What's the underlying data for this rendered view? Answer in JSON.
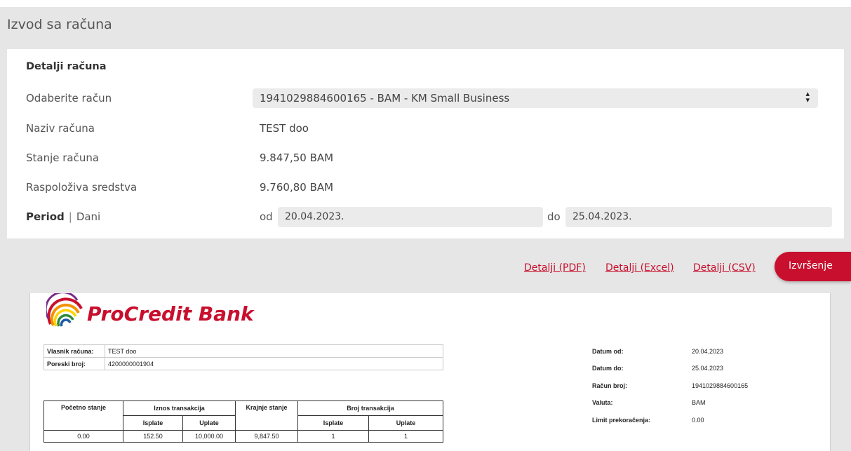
{
  "header": {
    "title": "Izvod sa računa"
  },
  "details": {
    "section_title": "Detalji računa",
    "select_account_label": "Odaberite račun",
    "select_account_value": "1941029884600165 - BAM - KM Small Business",
    "account_name_label": "Naziv računa",
    "account_name_value": "TEST doo",
    "balance_label": "Stanje računa",
    "balance_value": "9.847,50 BAM",
    "available_label": "Raspoloživa sredstva",
    "available_value": "9.760,80 BAM"
  },
  "period": {
    "label_period": "Period",
    "separator": "|",
    "label_days": "Dani",
    "from_prefix": "od",
    "from_value": "20.04.2023.",
    "to_prefix": "do",
    "to_value": "25.04.2023."
  },
  "actions": {
    "pdf_link": "Detalji (PDF)",
    "excel_link": "Detalji (Excel)",
    "csv_link": "Detalji (CSV)",
    "execute_button": "Izvršenje",
    "accent_color": "#c8102e"
  },
  "statement": {
    "bank_name": "ProCredit Bank",
    "owner_label": "Vlasnik računa:",
    "owner_value": "TEST doo",
    "tax_label": "Poreski broj:",
    "tax_value": "4200000001904",
    "table": {
      "col_opening": "Početno stanje",
      "col_amount": "Iznos transakcija",
      "col_closing": "Krajnje stanje",
      "col_count": "Broj transakcija",
      "sub_out": "Isplate",
      "sub_in": "Uplate",
      "sub_out2": "Isplate",
      "sub_in2": "Uplate",
      "row": {
        "opening": "0.00",
        "out_amount": "152.50",
        "in_amount": "10,000.00",
        "closing": "9,847.50",
        "out_count": "1",
        "in_count": "1"
      }
    },
    "meta": {
      "date_from_label": "Datum od:",
      "date_from_value": "20.04.2023",
      "date_to_label": "Datum do:",
      "date_to_value": "25.04.2023",
      "account_no_label": "Račun broj:",
      "account_no_value": "1941029884600165",
      "currency_label": "Valuta:",
      "currency_value": "BAM",
      "overdraft_label": "Limit prekoračenja:",
      "overdraft_value": "0.00"
    }
  }
}
